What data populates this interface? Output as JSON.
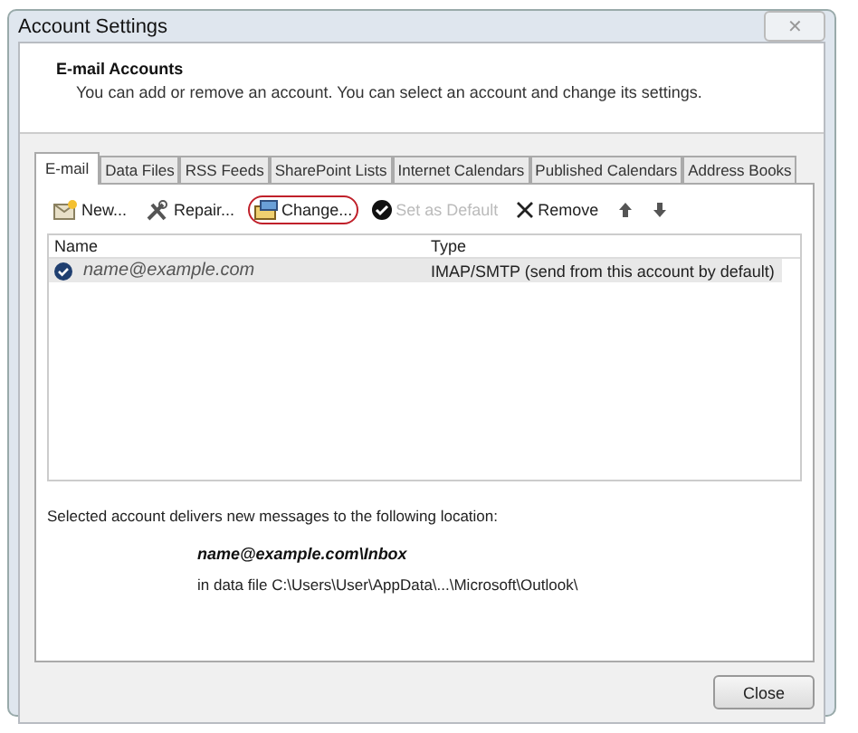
{
  "window": {
    "title": "Account Settings",
    "close_symbol": "✕"
  },
  "header": {
    "title": "E-mail Accounts",
    "description": "You can add or remove an account. You can select an account and change its settings."
  },
  "tabs": [
    {
      "label": "E-mail",
      "selected": true
    },
    {
      "label": "Data Files",
      "selected": false
    },
    {
      "label": "RSS Feeds",
      "selected": false
    },
    {
      "label": "SharePoint Lists",
      "selected": false
    },
    {
      "label": "Internet Calendars",
      "selected": false
    },
    {
      "label": "Published Calendars",
      "selected": false
    },
    {
      "label": "Address Books",
      "selected": false
    }
  ],
  "toolbar": [
    {
      "kind": "new",
      "label": "New...",
      "disabled": false,
      "highlighted": false
    },
    {
      "kind": "repair",
      "label": "Repair...",
      "disabled": false,
      "highlighted": false
    },
    {
      "kind": "change",
      "label": "Change...",
      "disabled": false,
      "highlighted": true
    },
    {
      "kind": "default",
      "label": "Set as Default",
      "disabled": true,
      "highlighted": false
    },
    {
      "kind": "remove",
      "label": "Remove",
      "disabled": false,
      "highlighted": false
    },
    {
      "kind": "up",
      "disabled": false,
      "highlighted": false
    },
    {
      "kind": "down",
      "disabled": false,
      "highlighted": false
    }
  ],
  "table": {
    "columns": [
      "Name",
      "Type"
    ],
    "rows": [
      {
        "name": "name@example.com",
        "type": "IMAP/SMTP (send from this account by default)",
        "is_default": true,
        "selected": true
      }
    ]
  },
  "delivery": {
    "caption": "Selected account delivers new messages to the following location:",
    "folder": "name@example.com\\Inbox",
    "data_file": "in data file C:\\Users\\User\\AppData\\...\\Microsoft\\Outlook\\"
  },
  "buttons": [
    "Close"
  ]
}
